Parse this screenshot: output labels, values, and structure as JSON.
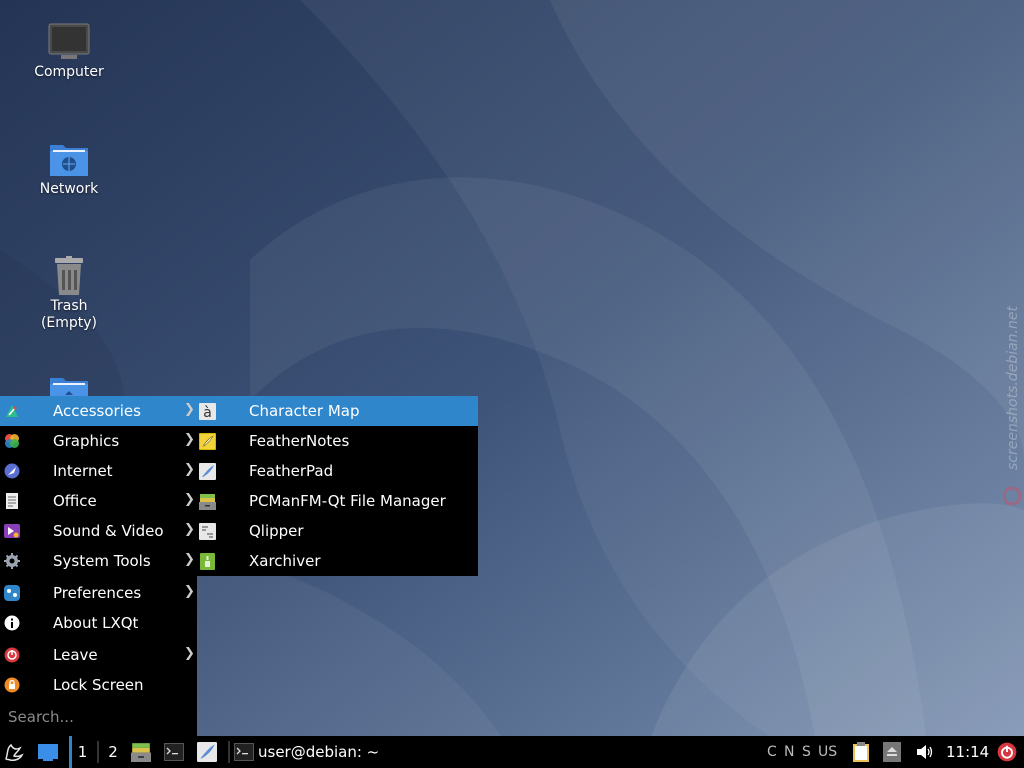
{
  "desktop": {
    "icons": [
      {
        "label": "Computer"
      },
      {
        "label": "Network"
      },
      {
        "label": "Trash\n(Empty)"
      }
    ],
    "watermark": "screenshots.debian.net"
  },
  "main_menu": {
    "items": [
      {
        "label": "Accessories",
        "icon": "accessories-icon",
        "submenu": true,
        "active": true
      },
      {
        "label": "Graphics",
        "icon": "graphics-icon",
        "submenu": true
      },
      {
        "label": "Internet",
        "icon": "internet-icon",
        "submenu": true
      },
      {
        "label": "Office",
        "icon": "office-icon",
        "submenu": true
      },
      {
        "label": "Sound & Video",
        "icon": "sound-video-icon",
        "submenu": true
      },
      {
        "label": "System Tools",
        "icon": "system-tools-icon",
        "submenu": true
      },
      {
        "label": "Preferences",
        "icon": "preferences-icon",
        "submenu": true
      },
      {
        "label": "About LXQt",
        "icon": "info-icon",
        "submenu": false
      },
      {
        "label": "Leave",
        "icon": "leave-icon",
        "submenu": true
      },
      {
        "label": "Lock Screen",
        "icon": "lock-icon",
        "submenu": false
      }
    ],
    "arrow": "❯",
    "search_placeholder": "Search..."
  },
  "accessories_submenu": {
    "items": [
      {
        "label": "Character Map",
        "icon": "character-map-icon",
        "active": true
      },
      {
        "label": "FeatherNotes",
        "icon": "feathernotes-icon"
      },
      {
        "label": "FeatherPad",
        "icon": "featherpad-icon"
      },
      {
        "label": "PCManFM-Qt File Manager",
        "icon": "file-manager-icon"
      },
      {
        "label": "Qlipper",
        "icon": "qlipper-icon"
      },
      {
        "label": "Xarchiver",
        "icon": "xarchiver-icon"
      }
    ],
    "char_map_glyph": "à"
  },
  "taskbar": {
    "workspaces": [
      "1",
      "2"
    ],
    "active_workspace": "1",
    "window_title": "user@debian: ~",
    "keyboard_indicators": [
      "C",
      "N",
      "S"
    ],
    "keyboard_layout": "US",
    "clock": "11:14"
  },
  "colors": {
    "accent": "#2f86cb",
    "menu_bg": "#000000",
    "wallpaper_base": "#3a4e74"
  }
}
